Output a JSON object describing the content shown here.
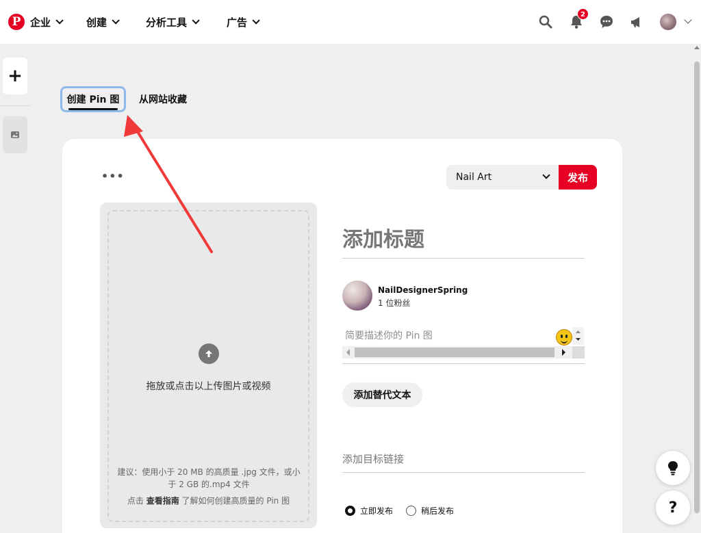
{
  "nav": {
    "logo": "P",
    "items": [
      {
        "label": "企业"
      },
      {
        "label": "创建"
      },
      {
        "label": "分析工具"
      },
      {
        "label": "广告"
      }
    ],
    "notification_count": "2",
    "icons": [
      "search-icon",
      "bell-icon",
      "chat-icon",
      "megaphone-icon"
    ]
  },
  "rail": {
    "add_label": "+"
  },
  "tabs": [
    {
      "label": "创建 Pin 图",
      "active": true
    },
    {
      "label": "从网站收藏",
      "active": false
    }
  ],
  "editor": {
    "more_label": "•••",
    "board_value": "Nail Art",
    "publish_label": "发布",
    "upload": {
      "text": "拖放或点击以上传图片或视频",
      "hint": "建议：使用小于 20 MB 的高质量 .jpg 文件，或小于 2 GB 的.mp4 文件",
      "guide_prefix": "点击 ",
      "guide_link": "查看指南",
      "guide_suffix": " 了解如何创建高质量的 Pin 图"
    },
    "title_placeholder": "添加标题",
    "user": {
      "name": "NailDesignerSpring",
      "followers": "1 位粉丝"
    },
    "description_placeholder": "简要描述你的 Pin 图",
    "alt_text_label": "添加替代文本",
    "link_placeholder": "添加目标链接",
    "publish_options": [
      {
        "label": "立即发布",
        "selected": true
      },
      {
        "label": "稍后发布",
        "selected": false
      }
    ]
  },
  "floating": {
    "tips_icon": "lightbulb-icon",
    "help_label": "?"
  },
  "colors": {
    "brand_red": "#e60023",
    "focus_ring": "#8fb9ea",
    "annotation_arrow": "#f03a3a"
  }
}
